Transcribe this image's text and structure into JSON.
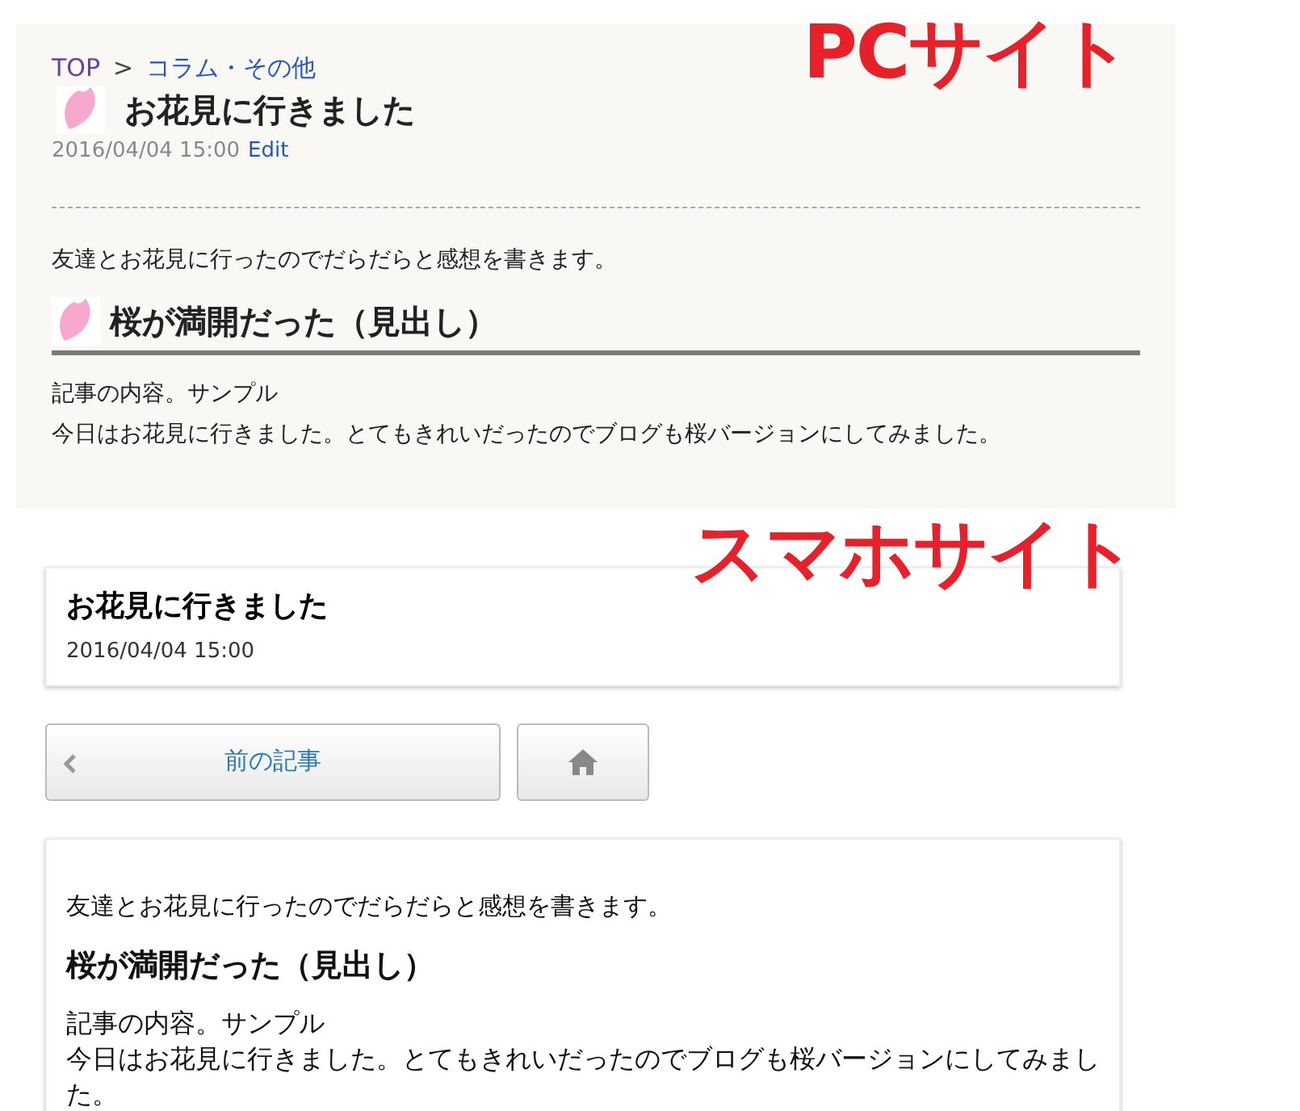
{
  "pc_site": {
    "label": "PCサイト",
    "breadcrumb": [
      {
        "text": "TOP",
        "visited": true
      },
      {
        "text": "コラム・その他",
        "visited": false
      }
    ],
    "breadcrumb_separator": ">",
    "title": "お花見に行きました",
    "date": "2016/04/04 15:00",
    "edit_link": "Edit",
    "intro": "友達とお花見に行ったのでだらだらと感想を書きます。",
    "heading": "桜が満開だった（見出し）",
    "body": [
      "記事の内容。サンプル",
      "今日はお花見に行きました。とてもきれいだったのでブログも桜バージョンにしてみました。"
    ]
  },
  "smartphone_site": {
    "label": "スマホサイト",
    "title": "お花見に行きました",
    "date": "2016/04/04 15:00",
    "prev_button": "前の記事",
    "intro": "友達とお花見に行ったのでだらだらと感想を書きます。",
    "heading": "桜が満開だった（見出し）",
    "body": [
      "記事の内容。サンプル",
      "今日はお花見に行きました。とてもきれいだったのでブログも桜バージョンにしてみました。"
    ]
  }
}
